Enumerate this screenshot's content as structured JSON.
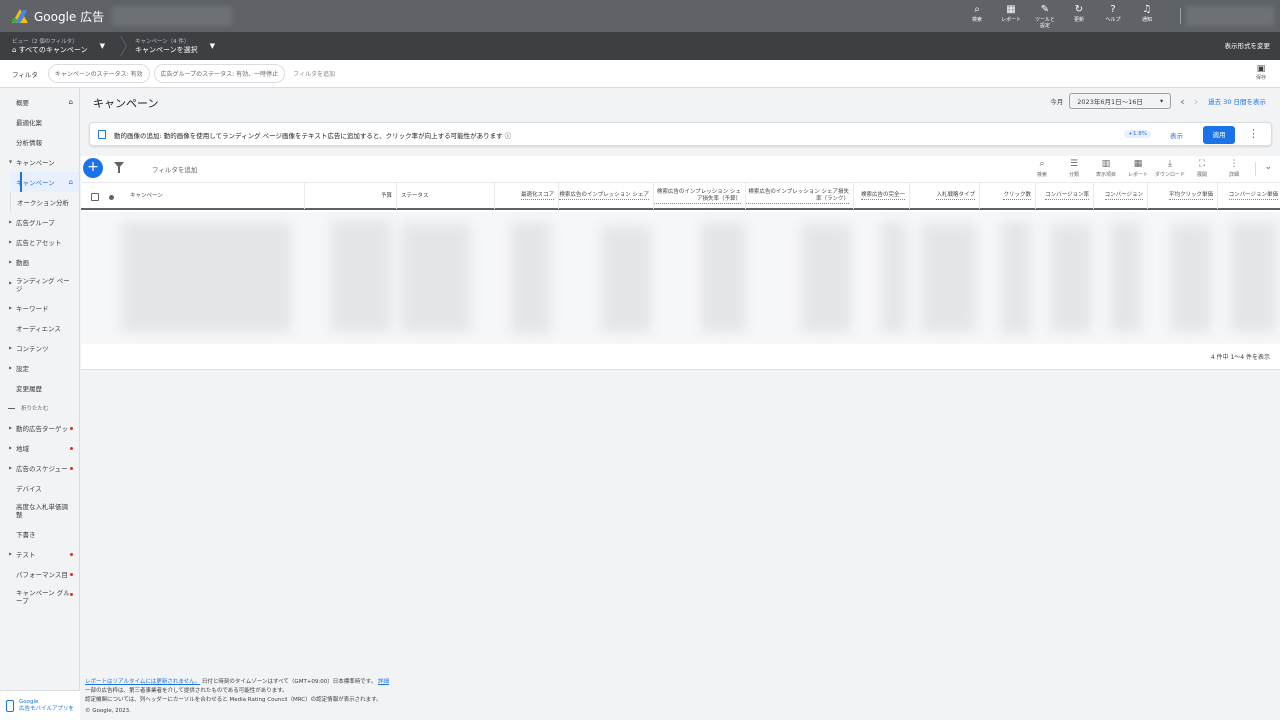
{
  "app": {
    "name": "Google 広告"
  },
  "topbar": {
    "actions": [
      {
        "icon": "search-icon",
        "glyph": "⌕",
        "label": "検索"
      },
      {
        "icon": "report-icon",
        "glyph": "▦",
        "label": "レポート"
      },
      {
        "icon": "tools-icon",
        "glyph": "✎",
        "label": "ツールと\n設定"
      },
      {
        "icon": "refresh-icon",
        "glyph": "↻",
        "label": "更新"
      },
      {
        "icon": "help-icon",
        "glyph": "?",
        "label": "ヘルプ"
      },
      {
        "icon": "bell-icon",
        "glyph": "♫",
        "label": "通知"
      }
    ]
  },
  "viewbar": {
    "view_small": "ビュー（2 個のフィルタ）",
    "view_main": "すべてのキャンペーン",
    "campaign_small": "キャンペーン（4 件）",
    "campaign_main": "キャンペーンを選択",
    "display_change": "表示形式を変更"
  },
  "filterbar": {
    "label": "フィルタ",
    "chips": [
      "キャンペーンのステータス: 有効",
      "広告グループのステータス: 有効、一時停止"
    ],
    "add": "フィルタを追加",
    "save": "保存"
  },
  "sidebar": {
    "items": [
      {
        "label": "概要",
        "arrow": false,
        "home": true
      },
      {
        "label": "最適化案",
        "arrow": false
      },
      {
        "label": "分析情報",
        "arrow": false
      },
      {
        "label": "キャンペーン",
        "arrow": true,
        "expanded": true
      },
      {
        "label": "キャンペーン",
        "sub": true,
        "active": true,
        "home": true
      },
      {
        "label": "オークション分析",
        "sub": true
      },
      {
        "label": "広告グループ",
        "arrow": true
      },
      {
        "label": "広告とアセット",
        "arrow": true
      },
      {
        "label": "動画",
        "arrow": true
      },
      {
        "label": "ランディング ページ",
        "arrow": true,
        "two": true
      },
      {
        "label": "キーワード",
        "arrow": true
      },
      {
        "label": "オーディエンス",
        "arrow": false
      },
      {
        "label": "コンテンツ",
        "arrow": true
      },
      {
        "label": "設定",
        "arrow": true
      },
      {
        "label": "変更履歴",
        "arrow": false
      }
    ],
    "collapse": "折りたたむ",
    "more_items": [
      {
        "label": "動的広告ターゲッ",
        "arrow": true,
        "dot": true
      },
      {
        "label": "地域",
        "arrow": true,
        "dot": true
      },
      {
        "label": "広告のスケジュー",
        "arrow": true,
        "dot": true
      },
      {
        "label": "デバイス",
        "arrow": false
      },
      {
        "label": "高度な入札単価調整",
        "arrow": false,
        "two": true
      },
      {
        "label": "下書き",
        "arrow": false
      },
      {
        "label": "テスト",
        "arrow": true,
        "dot": true
      },
      {
        "label": "パフォーマンス目",
        "arrow": false,
        "dot": true
      },
      {
        "label": "キャンペーン グループ",
        "arrow": false,
        "dot": true,
        "two": true
      }
    ],
    "promo_line1": "Google",
    "promo_line2": "広告モバイルアプリを"
  },
  "main": {
    "title": "キャンペーン",
    "date_preset": "今月",
    "date_range": "2023年6月1日～16日",
    "date_link": "過去 30 日間を表示",
    "banner": {
      "text": "動的画像の追加: 動的画像を使用してランディング ページ画像をテキスト広告に追加すると、クリック率が向上する可能性があります ⓘ",
      "uplift": "+1.8%",
      "view": "表示",
      "apply": "適用"
    },
    "toolbar": {
      "add_filter": "フィルタを追加",
      "actions": [
        {
          "icon": "search-icon",
          "glyph": "⌕",
          "label": "検索"
        },
        {
          "icon": "segment-icon",
          "glyph": "☰",
          "label": "分類"
        },
        {
          "icon": "columns-icon",
          "glyph": "▥",
          "label": "表示項目"
        },
        {
          "icon": "report-icon",
          "glyph": "▦",
          "label": "レポート"
        },
        {
          "icon": "download-icon",
          "glyph": "⤓",
          "label": "ダウンロード"
        },
        {
          "icon": "expand-icon",
          "glyph": "⛶",
          "label": "展開"
        },
        {
          "icon": "more-icon",
          "glyph": "⋮",
          "label": "詳細"
        }
      ]
    },
    "columns": [
      "キャンペーン",
      "予算",
      "ステータス",
      "最適化スコア",
      "検索広告のインプレッション シェア",
      "検索広告のインプレッション シェア損失率（予算）",
      "検索広告のインプレッション シェア損失率（ランク）",
      "検索広告の完全一",
      "入札戦略タイプ",
      "クリック数",
      "コンバージョン率",
      "コンバージョン",
      "平均クリック単価",
      "コンバージョン単価"
    ],
    "pagination": "4 件中 1～4 件を表示"
  },
  "footer": {
    "link1": "レポートはリアルタイムには更新されません。",
    "line1_rest": " 日付と時刻のタイムゾーンはすべて（GMT+09:00）日本標準時です。",
    "link2": "詳細",
    "line2": "一部の広告枠は、第三者事業者を介して提供されたものである可能性があります。",
    "line3": "認定機関については、列ヘッダーにカーソルを合わせると Media Rating Council（MRC）の認定情報が表示されます。",
    "line4": "© Google, 2023."
  }
}
